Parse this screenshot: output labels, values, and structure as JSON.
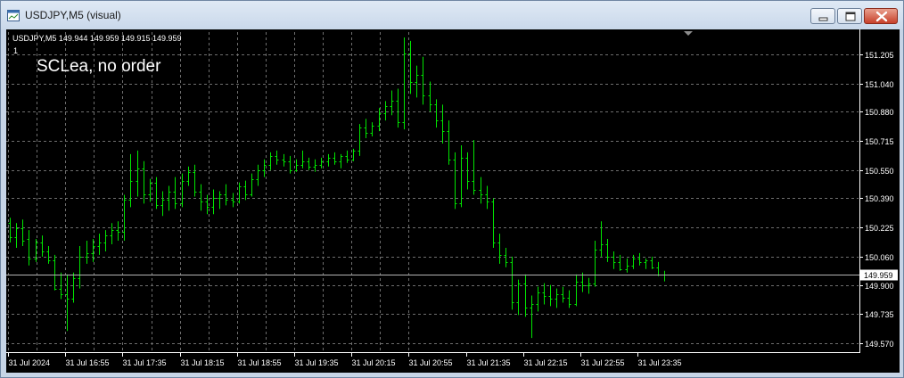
{
  "window": {
    "title": "USDJPY,M5 (visual)",
    "icon": "chart-window-icon",
    "controls": [
      "minimize-icon",
      "maximize-icon",
      "close-icon"
    ]
  },
  "chart": {
    "info_line": "USDJPY,M5  149.944 149.959 149.915 149.959",
    "sub_index": "1",
    "comment": "SCLea, no order"
  },
  "colors": {
    "background": "#000000",
    "candle": "#00e600",
    "grid": "#6e6e6e",
    "axis_text": "#ffffff",
    "price_line": "#b4b4b4",
    "price_tag_bg": "#ffffff",
    "price_tag_text": "#000000"
  },
  "chart_data": {
    "type": "ohlc",
    "symbol": "USDJPY",
    "timeframe": "M5",
    "ylim": [
      149.52,
      151.33
    ],
    "price_ticks": [
      "151.205",
      "151.040",
      "150.880",
      "150.715",
      "150.550",
      "150.390",
      "150.225",
      "150.060",
      "149.900",
      "149.735",
      "149.570"
    ],
    "time_ticks": [
      "31 Jul 2024",
      "31 Jul 16:55",
      "31 Jul 17:35",
      "31 Jul 18:15",
      "31 Jul 18:55",
      "31 Jul 19:35",
      "31 Jul 20:15",
      "31 Jul 20:55",
      "31 Jul 21:35",
      "31 Jul 22:15",
      "31 Jul 22:55",
      "31 Jul 23:35"
    ],
    "current_price": "149.959",
    "grid": true,
    "bars": [
      [
        150.25,
        150.28,
        150.14,
        150.17
      ],
      [
        150.17,
        150.25,
        150.11,
        150.22
      ],
      [
        150.22,
        150.27,
        150.12,
        150.15
      ],
      [
        150.16,
        150.21,
        150.01,
        150.05
      ],
      [
        150.05,
        150.16,
        150.03,
        150.14
      ],
      [
        150.14,
        150.18,
        150.06,
        150.09
      ],
      [
        150.09,
        150.12,
        150.02,
        150.04
      ],
      [
        150.04,
        150.07,
        149.87,
        149.88
      ],
      [
        149.88,
        149.97,
        149.82,
        149.85
      ],
      [
        149.85,
        149.96,
        149.64,
        149.82
      ],
      [
        149.82,
        149.97,
        149.8,
        149.94
      ],
      [
        149.94,
        150.12,
        149.88,
        150.06
      ],
      [
        150.06,
        150.15,
        150.02,
        150.08
      ],
      [
        150.08,
        150.16,
        150.03,
        150.12
      ],
      [
        150.12,
        150.19,
        150.07,
        150.14
      ],
      [
        150.14,
        150.21,
        150.09,
        150.18
      ],
      [
        150.18,
        150.25,
        150.13,
        150.21
      ],
      [
        150.21,
        150.26,
        150.15,
        150.2
      ],
      [
        150.2,
        150.41,
        150.15,
        150.38
      ],
      [
        150.38,
        150.64,
        150.34,
        150.49
      ],
      [
        150.49,
        150.66,
        150.4,
        150.56
      ],
      [
        150.56,
        150.6,
        150.36,
        150.41
      ],
      [
        150.41,
        150.5,
        150.37,
        150.48
      ],
      [
        150.48,
        150.51,
        150.33,
        150.35
      ],
      [
        150.35,
        150.43,
        150.29,
        150.38
      ],
      [
        150.38,
        150.46,
        150.32,
        150.43
      ],
      [
        150.43,
        150.51,
        150.33,
        150.36
      ],
      [
        150.36,
        150.53,
        150.34,
        150.49
      ],
      [
        150.49,
        150.57,
        150.46,
        150.54
      ],
      [
        150.54,
        150.58,
        150.4,
        150.43
      ],
      [
        150.43,
        150.47,
        150.32,
        150.37
      ],
      [
        150.37,
        150.41,
        150.3,
        150.34
      ],
      [
        150.34,
        150.44,
        150.3,
        150.39
      ],
      [
        150.39,
        150.43,
        150.33,
        150.41
      ],
      [
        150.41,
        150.47,
        150.35,
        150.38
      ],
      [
        150.38,
        150.42,
        150.34,
        150.37
      ],
      [
        150.37,
        150.48,
        150.36,
        150.46
      ],
      [
        150.46,
        150.49,
        150.38,
        150.41
      ],
      [
        150.41,
        150.53,
        150.4,
        150.5
      ],
      [
        150.5,
        150.58,
        150.46,
        150.55
      ],
      [
        150.55,
        150.61,
        150.51,
        150.58
      ],
      [
        150.58,
        150.65,
        150.55,
        150.63
      ],
      [
        150.63,
        150.66,
        150.58,
        150.61
      ],
      [
        150.61,
        150.64,
        150.57,
        150.6
      ],
      [
        150.6,
        150.63,
        150.53,
        150.55
      ],
      [
        150.55,
        150.61,
        150.54,
        150.58
      ],
      [
        150.58,
        150.66,
        150.56,
        150.6
      ],
      [
        150.6,
        150.62,
        150.55,
        150.57
      ],
      [
        150.57,
        150.61,
        150.54,
        150.58
      ],
      [
        150.58,
        150.62,
        150.56,
        150.6
      ],
      [
        150.6,
        150.64,
        150.57,
        150.62
      ],
      [
        150.62,
        150.65,
        150.58,
        150.6
      ],
      [
        150.6,
        150.64,
        150.56,
        150.63
      ],
      [
        150.63,
        150.66,
        150.59,
        150.61
      ],
      [
        150.61,
        150.67,
        150.6,
        150.66
      ],
      [
        150.66,
        150.81,
        150.63,
        150.79
      ],
      [
        150.79,
        150.84,
        150.73,
        150.76
      ],
      [
        150.76,
        150.82,
        150.74,
        150.8
      ],
      [
        150.8,
        150.9,
        150.77,
        150.87
      ],
      [
        150.87,
        150.94,
        150.83,
        150.91
      ],
      [
        150.91,
        151.0,
        150.86,
        150.94
      ],
      [
        150.94,
        151.01,
        150.79,
        150.82
      ],
      [
        150.82,
        151.3,
        150.78,
        151.21
      ],
      [
        151.21,
        151.28,
        150.98,
        151.05
      ],
      [
        151.05,
        151.14,
        150.96,
        151.09
      ],
      [
        151.09,
        151.19,
        150.92,
        150.97
      ],
      [
        150.97,
        151.05,
        150.88,
        150.92
      ],
      [
        150.92,
        150.95,
        150.79,
        150.83
      ],
      [
        150.83,
        150.92,
        150.7,
        150.77
      ],
      [
        150.77,
        150.83,
        150.58,
        150.61
      ],
      [
        150.61,
        150.65,
        150.33,
        150.36
      ],
      [
        150.36,
        150.69,
        150.34,
        150.62
      ],
      [
        150.62,
        150.65,
        150.44,
        150.49
      ],
      [
        150.49,
        150.72,
        150.41,
        150.44
      ],
      [
        150.44,
        150.51,
        150.36,
        150.41
      ],
      [
        150.41,
        150.46,
        150.33,
        150.37
      ],
      [
        150.37,
        150.39,
        150.11,
        150.14
      ],
      [
        150.14,
        150.19,
        150.02,
        150.07
      ],
      [
        150.07,
        150.11,
        150.0,
        150.03
      ],
      [
        150.03,
        150.06,
        149.76,
        149.8
      ],
      [
        149.8,
        149.93,
        149.73,
        149.91
      ],
      [
        149.91,
        149.96,
        149.72,
        149.77
      ],
      [
        149.77,
        149.84,
        149.6,
        149.79
      ],
      [
        149.79,
        149.89,
        149.75,
        149.86
      ],
      [
        149.86,
        149.91,
        149.79,
        149.84
      ],
      [
        149.84,
        149.9,
        149.78,
        149.82
      ],
      [
        149.82,
        149.88,
        149.77,
        149.85
      ],
      [
        149.85,
        149.89,
        149.8,
        149.83
      ],
      [
        149.83,
        149.87,
        149.77,
        149.79
      ],
      [
        149.79,
        149.96,
        149.78,
        149.92
      ],
      [
        149.92,
        149.97,
        149.86,
        149.9
      ],
      [
        149.9,
        149.94,
        149.85,
        149.91
      ],
      [
        149.91,
        150.15,
        149.89,
        150.1
      ],
      [
        150.1,
        150.26,
        150.06,
        150.13
      ],
      [
        150.13,
        150.16,
        150.03,
        150.06
      ],
      [
        150.06,
        150.09,
        149.99,
        150.03
      ],
      [
        150.03,
        150.07,
        149.98,
        149.99
      ],
      [
        149.99,
        150.05,
        149.97,
        150.01
      ],
      [
        150.01,
        150.07,
        149.99,
        150.05
      ],
      [
        150.05,
        150.08,
        150.01,
        150.03
      ],
      [
        150.03,
        150.05,
        149.99,
        150.04
      ],
      [
        150.04,
        150.06,
        149.99,
        150.0
      ],
      [
        150.0,
        150.03,
        149.95,
        149.96
      ],
      [
        149.96,
        149.98,
        149.92,
        149.96
      ]
    ]
  }
}
